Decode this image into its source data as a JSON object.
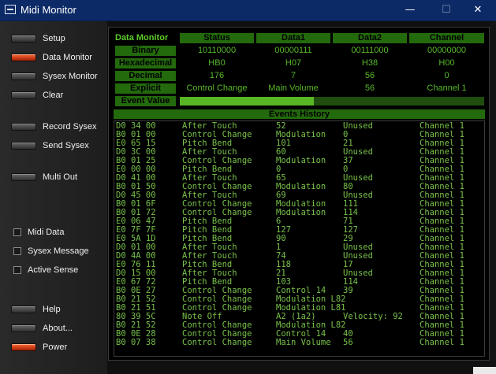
{
  "window": {
    "title": "Midi Monitor",
    "min": "—",
    "max": "☐",
    "close": "✕"
  },
  "sidebar": {
    "buttons": [
      {
        "label": "Setup",
        "on": false
      },
      {
        "label": "Data Monitor",
        "on": true
      },
      {
        "label": "Sysex Monitor",
        "on": false
      },
      {
        "label": "Clear",
        "on": false
      },
      {
        "label": "Record Sysex",
        "on": false
      },
      {
        "label": "Send Sysex",
        "on": false
      },
      {
        "label": "Multi Out",
        "on": false
      },
      {
        "label": "Help",
        "on": false
      },
      {
        "label": "About...",
        "on": false
      },
      {
        "label": "Power",
        "on": true
      }
    ],
    "checkboxes": [
      {
        "label": "Midi Data"
      },
      {
        "label": "Sysex Message"
      },
      {
        "label": "Active Sense"
      }
    ]
  },
  "monitor": {
    "title": "Data Monitor",
    "columns": [
      "Status",
      "Data1",
      "Data2",
      "Channel"
    ],
    "rows": [
      {
        "label": "Binary",
        "values": [
          "10110000",
          "00000111",
          "00111000",
          "00000000"
        ]
      },
      {
        "label": "Hexadecimal",
        "values": [
          "HB0",
          "H07",
          "H38",
          "H00"
        ]
      },
      {
        "label": "Decimal",
        "values": [
          "176",
          "7",
          "56",
          "0"
        ]
      },
      {
        "label": "Explicit",
        "values": [
          "Control Change",
          "Main Volume",
          "56",
          "Channel 1"
        ]
      }
    ],
    "event_value_label": "Event Value",
    "event_value_fraction": 0.44
  },
  "events": {
    "title": "Events History",
    "rows": [
      [
        "D0 34 00",
        "After Touch",
        "52",
        "Unused",
        "Channel 1"
      ],
      [
        "B0 01 00",
        "Control Change",
        "Modulation",
        "0",
        "Channel 1"
      ],
      [
        "E0 65 15",
        "Pitch Bend",
        "101",
        "21",
        "Channel 1"
      ],
      [
        "D0 3C 00",
        "After Touch",
        "60",
        "Unused",
        "Channel 1"
      ],
      [
        "B0 01 25",
        "Control Change",
        "Modulation",
        "37",
        "Channel 1"
      ],
      [
        "E0 00 00",
        "Pitch Bend",
        "0",
        "0",
        "Channel 1"
      ],
      [
        "D0 41 00",
        "After Touch",
        "65",
        "Unused",
        "Channel 1"
      ],
      [
        "B0 01 50",
        "Control Change",
        "Modulation",
        "80",
        "Channel 1"
      ],
      [
        "D0 45 00",
        "After Touch",
        "69",
        "Unused",
        "Channel 1"
      ],
      [
        "B0 01 6F",
        "Control Change",
        "Modulation",
        "111",
        "Channel 1"
      ],
      [
        "B0 01 72",
        "Control Change",
        "Modulation",
        "114",
        "Channel 1"
      ],
      [
        "E0 06 47",
        "Pitch Bend",
        "6",
        "71",
        "Channel 1"
      ],
      [
        "E0 7F 7F",
        "Pitch Bend",
        "127",
        "127",
        "Channel 1"
      ],
      [
        "E0 5A 1D",
        "Pitch Bend",
        "90",
        "29",
        "Channel 1"
      ],
      [
        "D0 01 00",
        "After Touch",
        "1",
        "Unused",
        "Channel 1"
      ],
      [
        "D0 4A 00",
        "After Touch",
        "74",
        "Unused",
        "Channel 1"
      ],
      [
        "E0 76 11",
        "Pitch Bend",
        "118",
        "17",
        "Channel 1"
      ],
      [
        "D0 15 00",
        "After Touch",
        "21",
        "Unused",
        "Channel 1"
      ],
      [
        "E0 67 72",
        "Pitch Bend",
        "103",
        "114",
        "Channel 1"
      ],
      [
        "B0 0E 27",
        "Control Change",
        "Control 14",
        "39",
        "Channel 1"
      ],
      [
        "B0 21 52",
        "Control Change",
        "Modulation L82",
        "",
        "Channel 1"
      ],
      [
        "B0 21 51",
        "Control Change",
        "Modulation L81",
        "",
        "Channel 1"
      ],
      [
        "80 39 5C",
        "Note Off",
        "A2 (1a2)",
        "Velocity: 92",
        "Channel 1"
      ],
      [
        "B0 21 52",
        "Control Change",
        "Modulation L82",
        "",
        "Channel 1"
      ],
      [
        "B0 0E 28",
        "Control Change",
        "Control 14",
        "40",
        "Channel 1"
      ],
      [
        "B0 07 38",
        "Control Change",
        "Main Volume",
        "56",
        "Channel 1"
      ]
    ]
  }
}
